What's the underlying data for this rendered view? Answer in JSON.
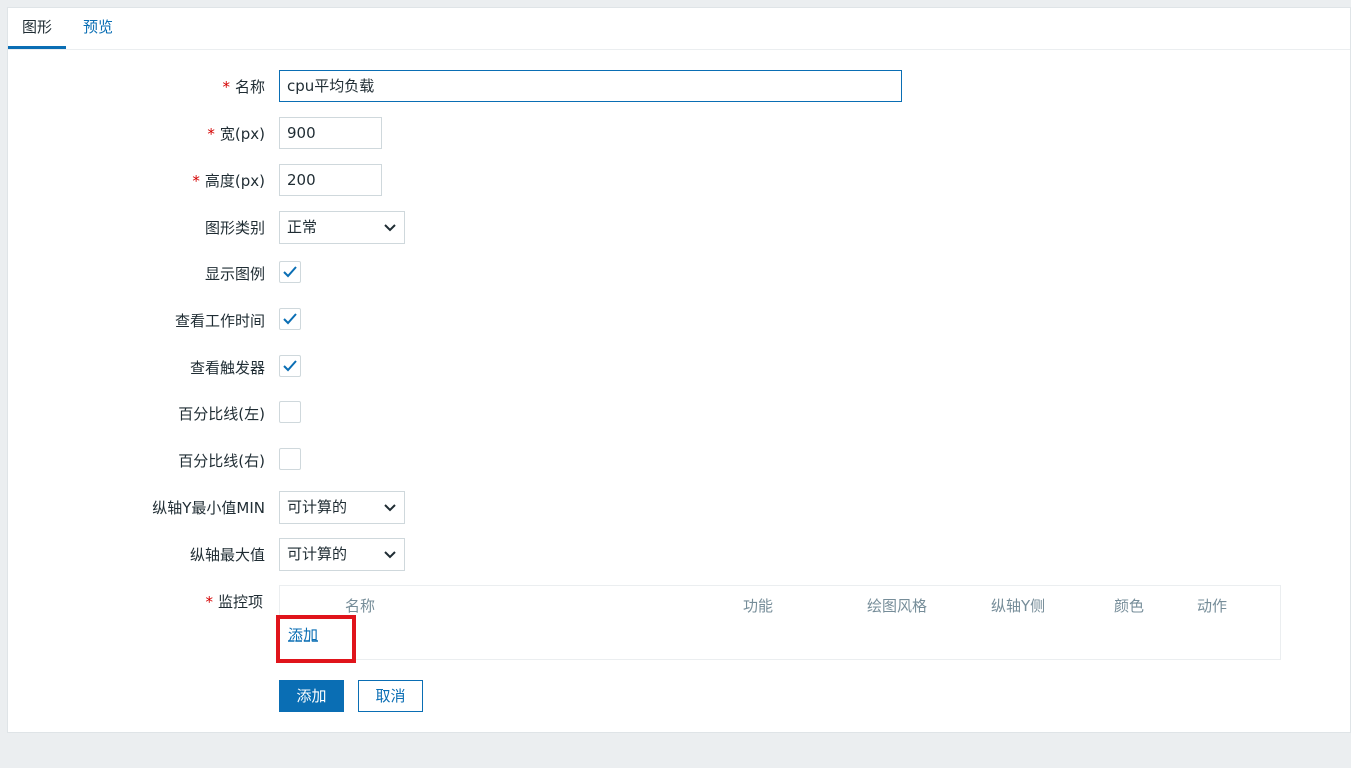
{
  "tabs": [
    {
      "label": "图形"
    },
    {
      "label": "预览"
    }
  ],
  "form": {
    "name": {
      "label": "名称",
      "required": true,
      "value": "cpu平均负载"
    },
    "width": {
      "label": "宽(px)",
      "required": true,
      "value": "900"
    },
    "height": {
      "label": "高度(px)",
      "required": true,
      "value": "200"
    },
    "graph_type": {
      "label": "图形类别",
      "value": "正常"
    },
    "show_legend": {
      "label": "显示图例",
      "checked": true
    },
    "show_working_time": {
      "label": "查看工作时间",
      "checked": true
    },
    "show_triggers": {
      "label": "查看触发器",
      "checked": true
    },
    "percentile_left": {
      "label": "百分比线(左)",
      "checked": false
    },
    "percentile_right": {
      "label": "百分比线(右)",
      "checked": false
    },
    "ymin_type": {
      "label": "纵轴Y最小值MIN",
      "value": "可计算的"
    },
    "ymax_type": {
      "label": "纵轴最大值",
      "value": "可计算的"
    },
    "items": {
      "label": "监控项",
      "required": true,
      "columns": [
        "名称",
        "功能",
        "绘图风格",
        "纵轴Y侧",
        "颜色",
        "动作"
      ],
      "add_link": "添加"
    }
  },
  "buttons": {
    "add": "添加",
    "cancel": "取消"
  },
  "colors": {
    "accent": "#0a6eb4",
    "required": "#d40000",
    "highlight": "#e0141b"
  }
}
